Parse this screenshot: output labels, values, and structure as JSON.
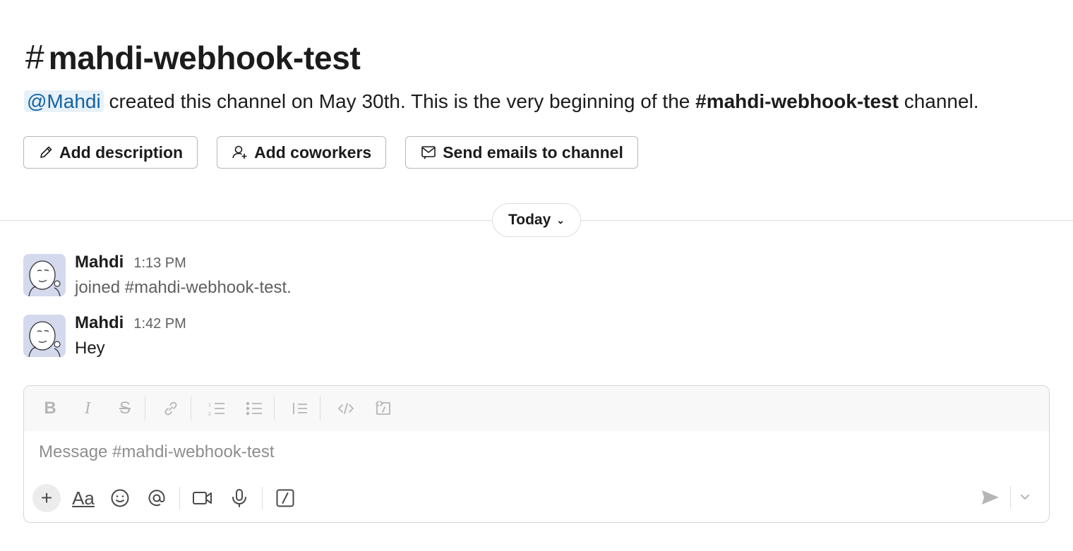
{
  "channel": {
    "hash": "#",
    "name": "mahdi-webhook-test"
  },
  "intro": {
    "mention": "@Mahdi",
    "text_before": " created this channel on May 30th. This is the very beginning of the ",
    "channel_hash": "#",
    "channel_name": "mahdi-webhook-test",
    "text_after": " channel."
  },
  "actions": {
    "add_description": "Add description",
    "add_coworkers": "Add coworkers",
    "send_emails": "Send emails to channel"
  },
  "date_divider": {
    "label": "Today"
  },
  "messages": [
    {
      "author": "Mahdi",
      "time": "1:13 PM",
      "text": "joined #mahdi-webhook-test.",
      "system": true
    },
    {
      "author": "Mahdi",
      "time": "1:42 PM",
      "text": "Hey",
      "system": false
    }
  ],
  "composer": {
    "placeholder": "Message #mahdi-webhook-test",
    "format_buttons": [
      "bold-icon",
      "italic-icon",
      "strikethrough-icon",
      "link-icon",
      "ordered-list-icon",
      "bulleted-list-icon",
      "blockquote-icon",
      "code-icon",
      "code-block-icon"
    ],
    "tools": [
      "plus-icon",
      "formatting-aa-icon",
      "emoji-icon",
      "mention-icon",
      "video-icon",
      "microphone-icon",
      "slash-command-icon"
    ],
    "aa_label": "Aa"
  },
  "colors": {
    "link": "#1264a3",
    "mention_bg": "#e8f1f8",
    "text": "#1d1c1d",
    "muted": "#616061"
  }
}
